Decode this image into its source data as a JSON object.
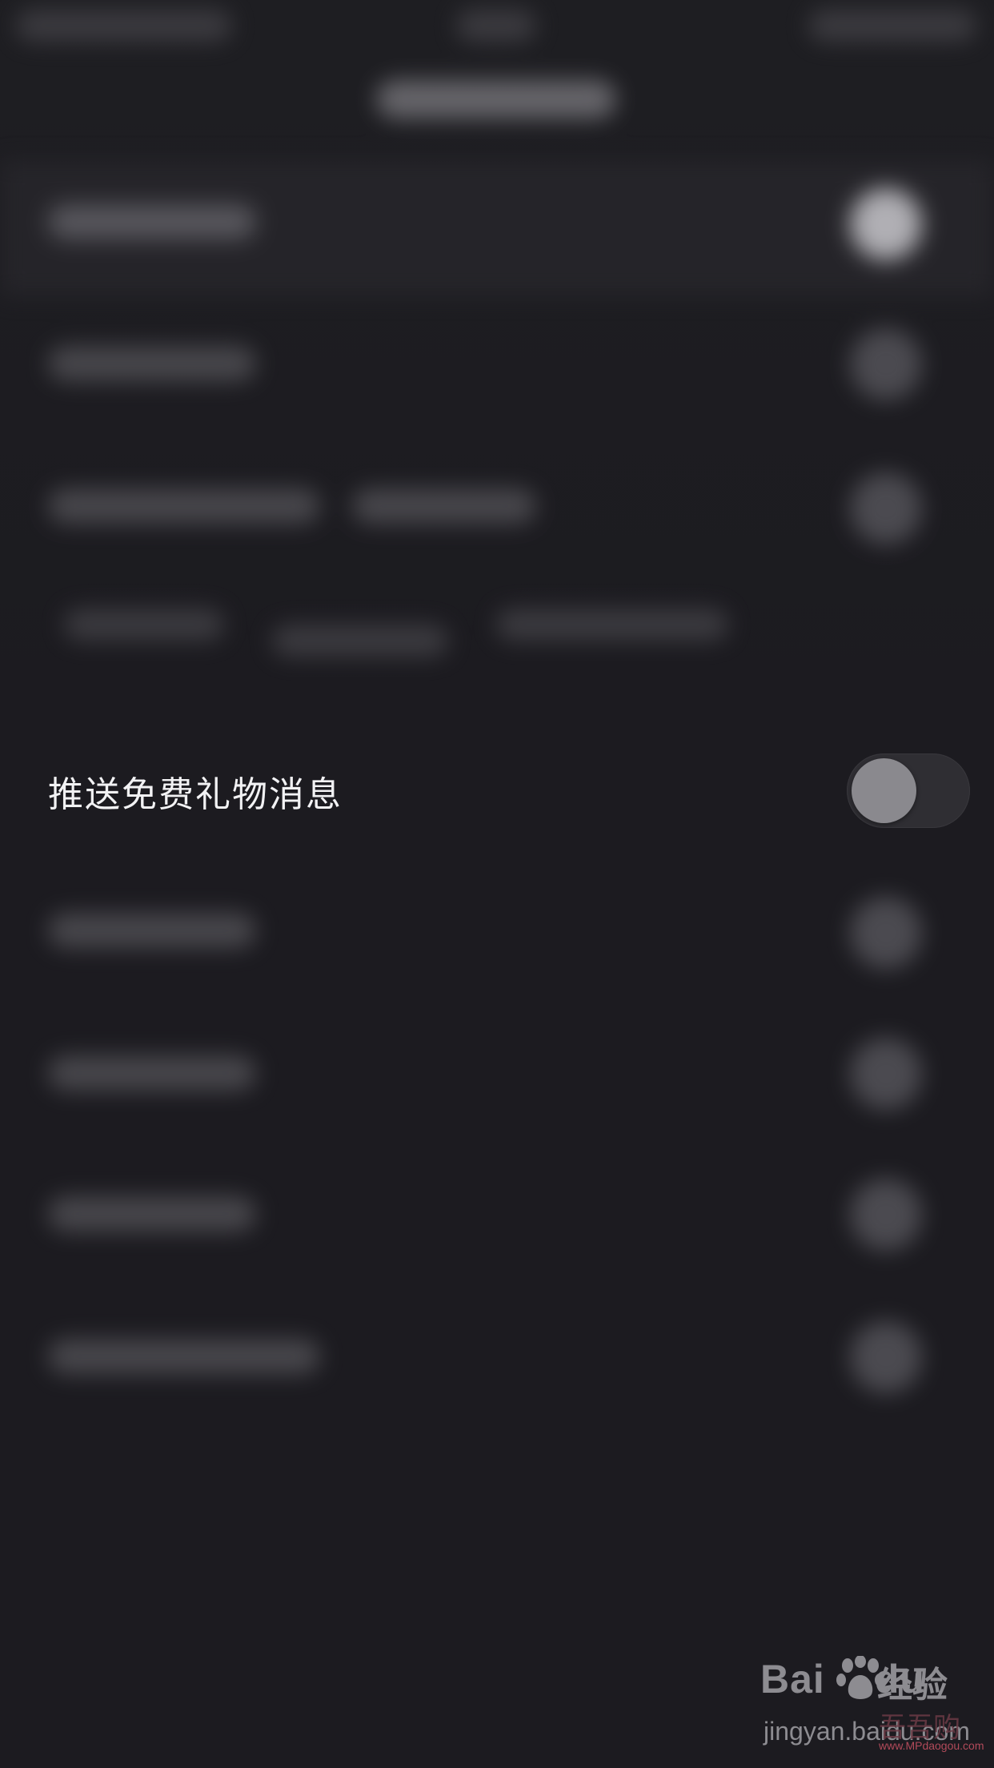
{
  "setting_row": {
    "label": "推送免费礼物消息",
    "toggle_on": false
  },
  "watermark": {
    "logo_text": "Bai",
    "logo_text_end": "du",
    "brand_suffix": "经验",
    "url": "jingyan.baidu.com",
    "overlay_mark": "吾吾购",
    "overlay_url": "www.MPdaogou.com"
  },
  "colors": {
    "background": "#1c1b20",
    "toggle_track": "#2f2e33",
    "toggle_knob": "#8a898e",
    "label_text": "#f2f2f4"
  }
}
